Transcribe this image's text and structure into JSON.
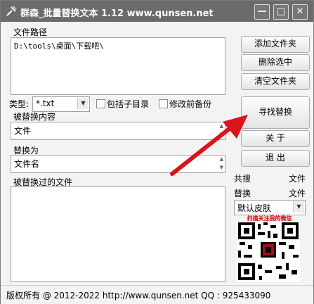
{
  "window": {
    "title": "群森_批量替换文本  1.12   www.qunsen.net",
    "controls": {
      "minimize": "—",
      "maximize": "□",
      "close": "✕"
    }
  },
  "file_path": {
    "label": "文件路径",
    "value": "D:\\tools\\桌面\\下载吧\\"
  },
  "buttons": {
    "add_folder": "添加文件夹",
    "delete_selected": "删除选中",
    "clear_folder": "清空文件夹",
    "find_replace": "寻找替换",
    "about": "关  于",
    "exit": "退  出"
  },
  "type_filter": {
    "label": "类型:",
    "value": "*.txt",
    "include_subdirs": {
      "label": "包括子目录",
      "checked": false
    },
    "backup_before": {
      "label": "修改前备份",
      "checked": false
    }
  },
  "replaced_content": {
    "label": "被替换内容",
    "value": "文件"
  },
  "replace_with": {
    "label": "替换为",
    "value": "文件名"
  },
  "replaced_files": {
    "label": "被替换过的文件"
  },
  "summary": {
    "searched_label": "共搜",
    "searched_unit": "文件",
    "replaced_label": "替换",
    "replaced_unit": "文件"
  },
  "skin": {
    "selected": "默认皮肤"
  },
  "qr": {
    "caption": "扫描关注我的微信"
  },
  "status": {
    "text": "版权所有 @ 2012-2022   http://www.qunsen.net   QQ : 925433090"
  },
  "colors": {
    "titlebar": "#6b6b6b",
    "arrow": "#d9141b",
    "qr_accent": "#cc0000"
  }
}
